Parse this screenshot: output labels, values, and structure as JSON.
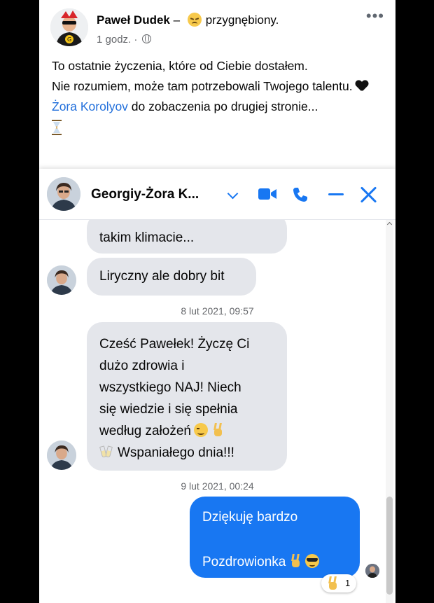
{
  "post": {
    "author": "Paweł Dudek",
    "separator": " – ",
    "feeling": "przygnębiony.",
    "time": "1 godz.",
    "dot": " · ",
    "text_line1": "To ostatnie życzenia, które od Ciebie dostałem.",
    "text_line2": "Nie rozumiem, może tam potrzebowali Twojego talentu.",
    "mention": "Żora Korolyov",
    "text_line3": " do zobaczenia po drugiej stronie..."
  },
  "chat": {
    "contact_name": "Georgiy-Żora K...",
    "messages": {
      "m1": "takim klimacie...",
      "m2": "Liryczny ale dobry bit",
      "ts1": "8 lut 2021, 09:57",
      "m3_l1": "Cześć Pawełek! Życzę Ci",
      "m3_l2": "dużo zdrowia i",
      "m3_l3": "wszystkiego NAJ! Niech",
      "m3_l4": "się wiedzie i się spełnia",
      "m3_l5": "według założeń",
      "m3_l6": "Wspaniałego dnia!!!",
      "ts2": "9 lut 2021, 00:24",
      "m4_l1": "Dziękuję bardzo",
      "m4_l2": "Pozdrowionka"
    },
    "reaction_count": "1"
  },
  "colors": {
    "accent": "#1877f2",
    "bubble_in": "#e4e6eb",
    "link": "#216fdb"
  },
  "icons": [
    "more-icon",
    "globe-icon",
    "heart-icon",
    "hourglass-icon",
    "chevron-down-icon",
    "video-icon",
    "phone-icon",
    "minimize-icon",
    "close-icon",
    "wink-emoji",
    "victory-emoji",
    "cheers-emoji",
    "sunglasses-emoji"
  ]
}
